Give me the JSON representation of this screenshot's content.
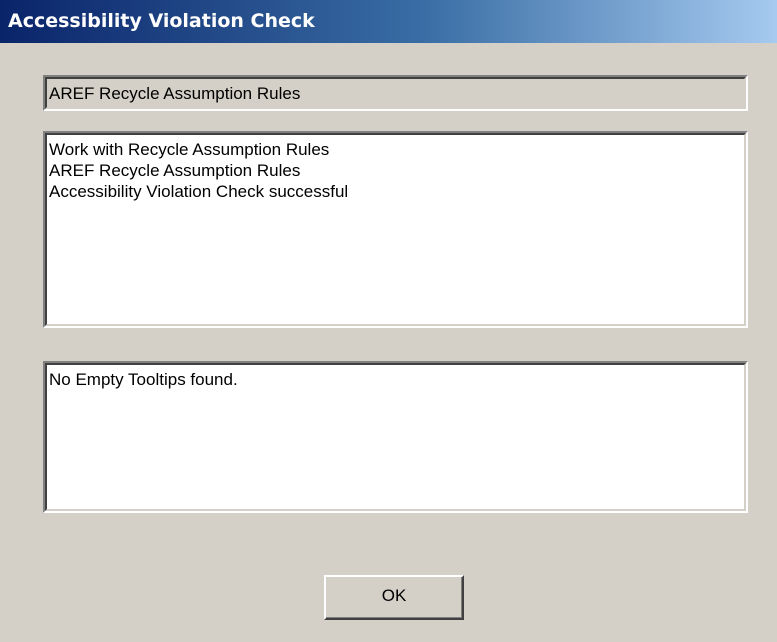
{
  "window": {
    "title": "Accessibility Violation Check",
    "titlebar_colors": [
      "#0a246a",
      "#3a6ea5",
      "#a6caf0"
    ],
    "background": "#d4d0c8"
  },
  "rule_name_field": {
    "value": "AREF Recycle Assumption Rules"
  },
  "summary_list": {
    "items": [
      "Work with Recycle Assumption Rules",
      "AREF Recycle Assumption Rules",
      "Accessibility Violation Check successful"
    ]
  },
  "results_list": {
    "items": [
      "No Empty Tooltips found."
    ]
  },
  "buttons": {
    "ok_label": "OK"
  }
}
